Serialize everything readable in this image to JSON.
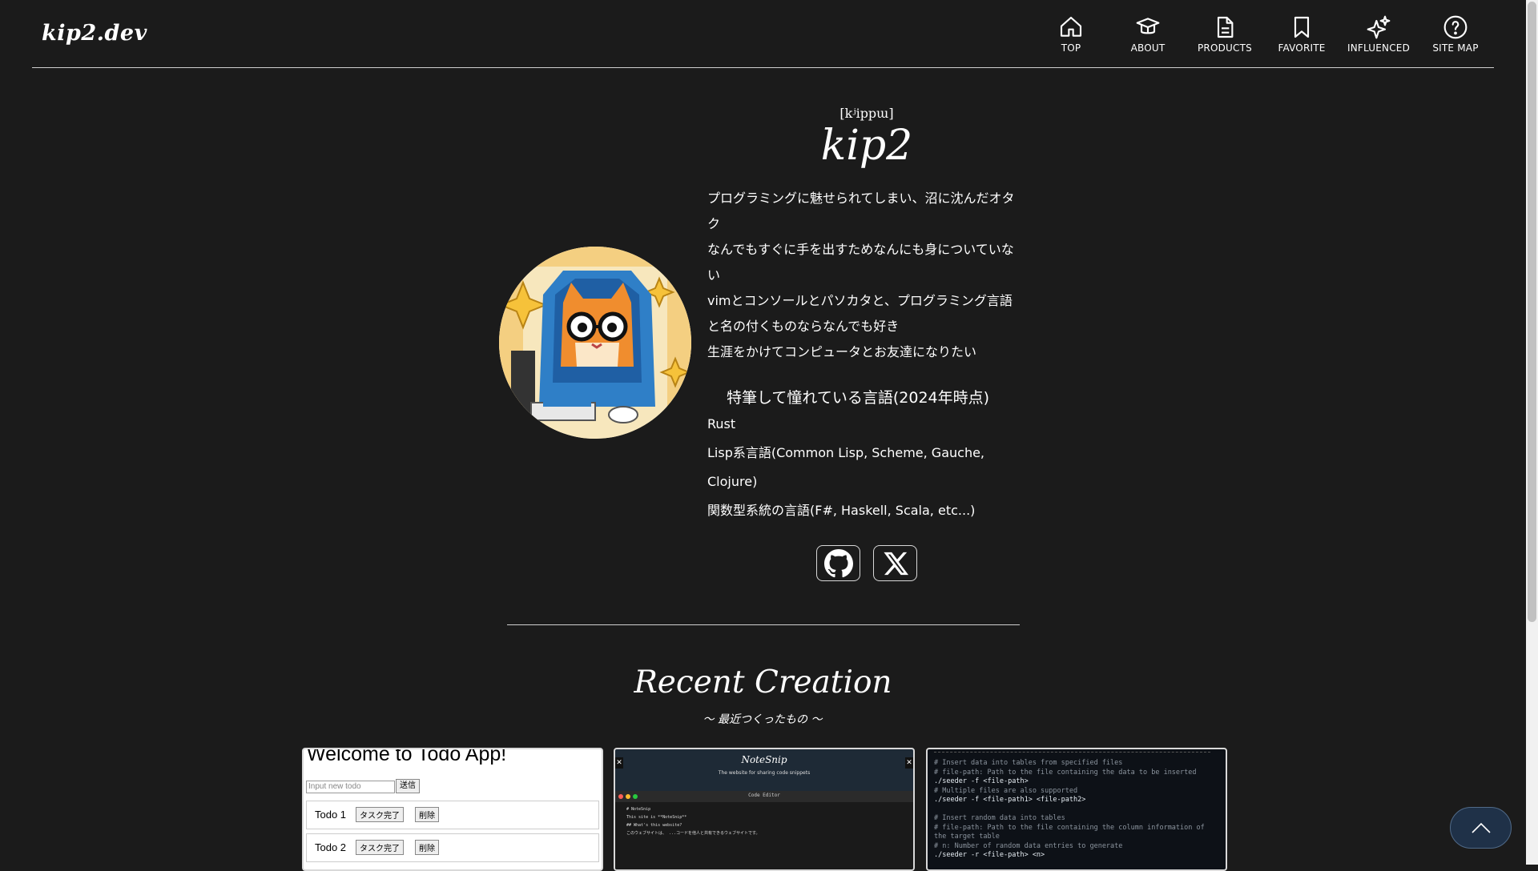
{
  "header": {
    "logo": "kip2.dev",
    "nav": [
      {
        "label": "TOP",
        "icon": "home-icon"
      },
      {
        "label": "ABOUT",
        "icon": "graduation-cap-icon"
      },
      {
        "label": "PRODUCTS",
        "icon": "document-icon"
      },
      {
        "label": "FAVORITE",
        "icon": "bookmark-icon"
      },
      {
        "label": "INFLUENCED",
        "icon": "sparkles-icon"
      },
      {
        "label": "SITE MAP",
        "icon": "help-circle-icon"
      }
    ]
  },
  "profile": {
    "phonetic": "[kʲippɯ]",
    "name": "kip2",
    "avatar": "pixel-art-cat-with-glasses-icon",
    "bio": [
      "プログラミングに魅せられてしまい、沼に沈んだオタク",
      "なんでもすぐに手を出すためなんにも身についていない",
      "vimとコンソールとパソカタと、プログラミング言語と名の付くものならなんでも好き",
      "生涯をかけてコンピュータとお友達になりたい"
    ],
    "languages_heading": "特筆して憧れている言語(2024年時点)",
    "languages": [
      "Rust",
      "Lisp系言語(Common Lisp, Scheme, Gauche, Clojure)",
      "関数型系統の言語(F#, Haskell, Scala, etc...)"
    ],
    "socials": [
      {
        "name": "GitHub",
        "icon": "github-icon"
      },
      {
        "name": "X",
        "icon": "x-icon"
      }
    ]
  },
  "recent": {
    "title": "Recent Creation",
    "subtitle": "〜 最近つくったもの 〜",
    "cards": {
      "todo": {
        "title": "Welcome to Todo App!",
        "input_placeholder": "Input new todo",
        "send": "送信",
        "rows": [
          {
            "label": "Todo 1",
            "done": "タスク完了",
            "delete": "削除"
          },
          {
            "label": "Todo 2",
            "done": "タスク完了",
            "delete": "削除"
          }
        ]
      },
      "notesnip": {
        "brand": "NoteSnip",
        "tagline": "The website for sharing code snippets",
        "editor_label": "Code Editor",
        "lines": [
          "# NoteSnip",
          "This site is **NoteSnip**",
          "## What's this website?",
          "このウェブサイトは、 ...コードを他人と共有できるウェブサイトです。"
        ]
      },
      "seeder": {
        "lines": [
          {
            "text": "# Insert data into tables from specified files",
            "kind": "c"
          },
          {
            "text": "# file-path: Path to the file containing the data to be inserted",
            "kind": "c"
          },
          {
            "text": "./seeder -f <file-path>",
            "kind": "w"
          },
          {
            "text": "# Multiple files are also supported",
            "kind": "c"
          },
          {
            "text": "./seeder -f <file-path1> <file-path2>",
            "kind": "w"
          },
          {
            "text": "",
            "kind": "w"
          },
          {
            "text": "# Insert random data into tables",
            "kind": "c"
          },
          {
            "text": "# file-path: Path to the file containing the column information of",
            "kind": "c"
          },
          {
            "text": "the target table",
            "kind": "c"
          },
          {
            "text": "# n: Number of random data entries to generate",
            "kind": "c"
          },
          {
            "text": "./seeder -r <file-path> <n>",
            "kind": "w"
          }
        ]
      }
    }
  },
  "colors": {
    "background": "#1b1b1b",
    "text": "#ffffff",
    "scroll_top_bg": "#1f3148"
  }
}
